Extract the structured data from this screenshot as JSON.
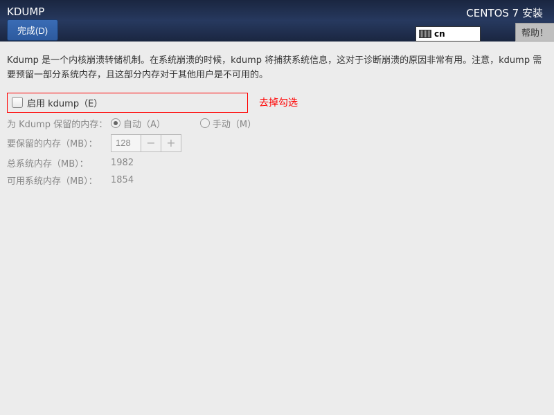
{
  "header": {
    "title": "KDUMP",
    "subtitle": "CENTOS 7 安装",
    "done_label": "完成(D)",
    "help_label": "帮助！",
    "keyboard": "cn"
  },
  "description": "Kdump 是一个内核崩溃转储机制。在系统崩溃的时候，kdump 将捕获系统信息，这对于诊断崩溃的原因非常有用。注意，kdump 需要预留一部分系统内存，且这部分内存对于其他用户是不可用的。",
  "enable": {
    "label": "启用 kdump（E）",
    "checked": false
  },
  "annotation": "去掉勾选",
  "reserve": {
    "label": "为 Kdump 保留的内存：",
    "options": {
      "auto": {
        "label": "自动（A）",
        "selected": true
      },
      "manual": {
        "label": "手动（M）",
        "selected": false
      }
    }
  },
  "memory": {
    "reserve_label": "要保留的内存（MB）：",
    "reserve_value": "128",
    "total_label": "总系统内存（MB）：",
    "total_value": "1982",
    "avail_label": "可用系统内存（MB）：",
    "avail_value": "1854"
  }
}
